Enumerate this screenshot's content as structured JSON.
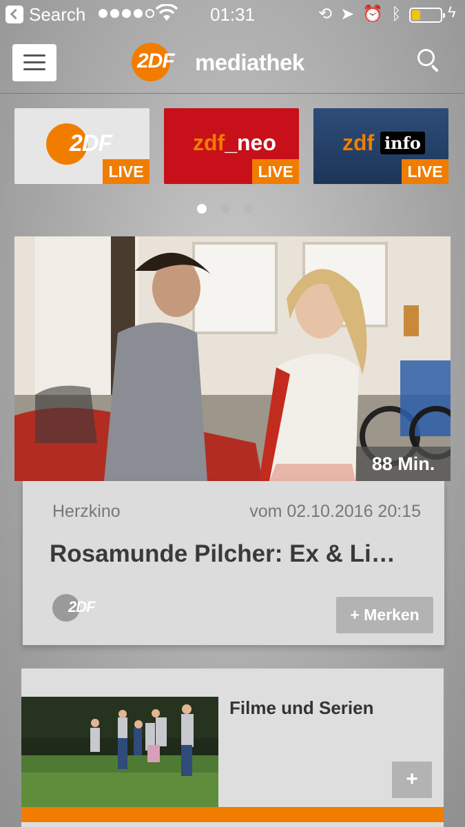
{
  "status_bar": {
    "back_label": "Search",
    "time": "01:31",
    "signal_dots": 5,
    "signal_filled": 4,
    "battery_level": 0.3,
    "battery_color": "#f5c400"
  },
  "navbar": {
    "logo_mark": "2DF",
    "logo_text": "mediathek",
    "accent_color": "#f07d00"
  },
  "channels": [
    {
      "name": "2DF",
      "badge": "LIVE",
      "color": "#e6e6e6"
    },
    {
      "name_prefix": "zdf",
      "name_suffix": "_neo",
      "badge": "LIVE",
      "color": "#c8101a"
    },
    {
      "name_prefix": "zdf",
      "name_suffix": "info",
      "badge": "LIVE",
      "color": "#2d4d78"
    }
  ],
  "pager": {
    "count": 3,
    "active": 0
  },
  "feature": {
    "duration": "88 Min.",
    "genre": "Herzkino",
    "date": "vom 02.10.2016 20:15",
    "title": "Rosamunde Pilcher: Ex & Li…",
    "channel_logo": "2DF",
    "merken_label": "+ Merken"
  },
  "category": {
    "title": "Filme und Serien",
    "plus_label": "+"
  }
}
